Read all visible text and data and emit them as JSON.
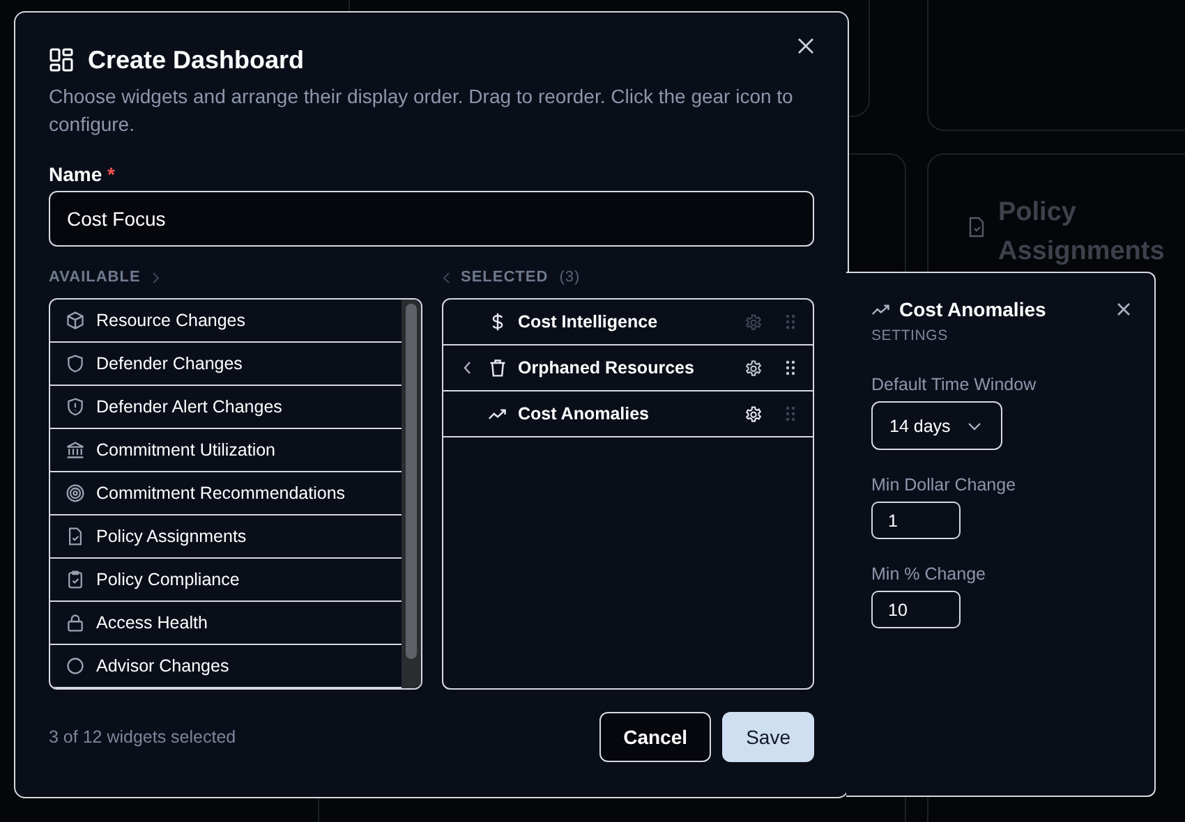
{
  "background": {
    "card_title": "Policy Assignments"
  },
  "dialog": {
    "title": "Create Dashboard",
    "description": "Choose widgets and arrange their display order. Drag to reorder. Click the gear icon to configure.",
    "name_field": {
      "label": "Name",
      "required_mark": "*",
      "value": "Cost Focus"
    },
    "available": {
      "heading": "AVAILABLE",
      "items": [
        {
          "label": "Resource Changes",
          "kind": "cube"
        },
        {
          "label": "Defender Changes",
          "kind": "shield"
        },
        {
          "label": "Defender Alert Changes",
          "kind": "shield-alert"
        },
        {
          "label": "Commitment Utilization",
          "kind": "bank"
        },
        {
          "label": "Commitment Recommendations",
          "kind": "target"
        },
        {
          "label": "Policy Assignments",
          "kind": "doc-check"
        },
        {
          "label": "Policy Compliance",
          "kind": "clipboard"
        },
        {
          "label": "Access Health",
          "kind": "lock"
        },
        {
          "label": "Advisor Changes",
          "kind": "circle"
        }
      ]
    },
    "selected": {
      "heading": "SELECTED",
      "count": "(3)",
      "items": [
        {
          "label": "Cost Intelligence",
          "kind": "dollar",
          "hovered": false,
          "configuring": false
        },
        {
          "label": "Orphaned Resources",
          "kind": "trash",
          "hovered": true,
          "configuring": false
        },
        {
          "label": "Cost Anomalies",
          "kind": "trend",
          "hovered": false,
          "configuring": true
        }
      ]
    },
    "footer": {
      "summary": "3 of 12 widgets selected",
      "buttons": [
        {
          "label": "Cancel",
          "kind": "secondary"
        },
        {
          "label": "Save",
          "kind": "primary"
        }
      ]
    }
  },
  "settings_panel": {
    "title": "Cost Anomalies",
    "subtitle": "SETTINGS",
    "fields": [
      {
        "kind": "select",
        "label": "Default Time Window",
        "value": "14 days"
      },
      {
        "kind": "input",
        "label": "Min Dollar Change",
        "value": "1"
      },
      {
        "kind": "input",
        "label": "Min % Change",
        "value": "10"
      }
    ]
  }
}
